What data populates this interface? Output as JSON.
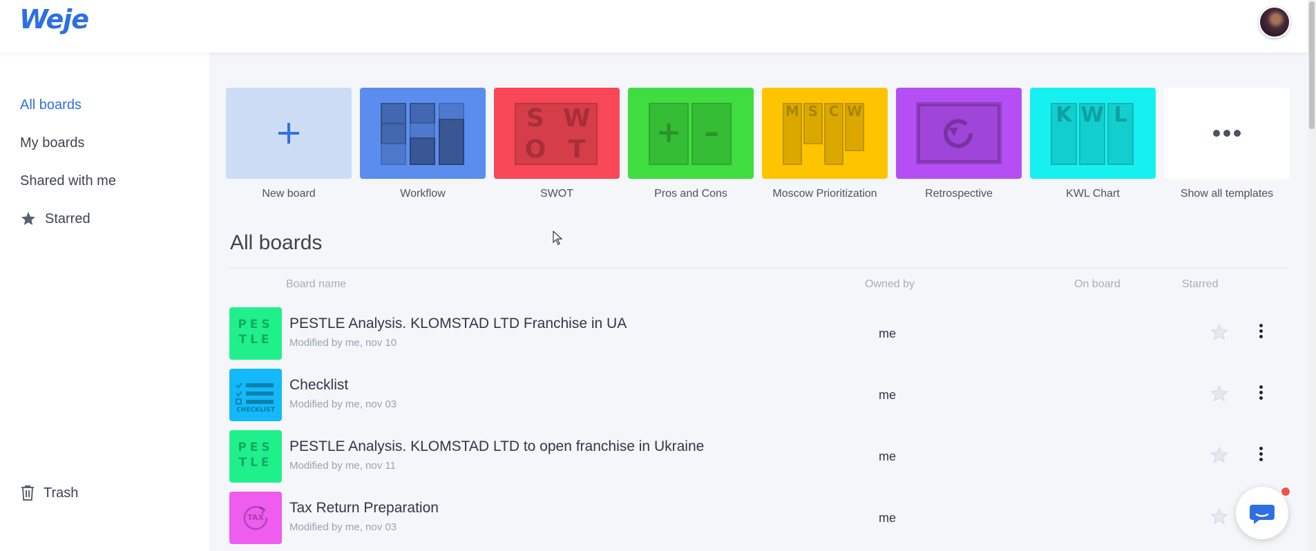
{
  "app": {
    "logo": "Weje"
  },
  "sidebar": {
    "items": [
      {
        "label": "All boards",
        "active": true
      },
      {
        "label": "My boards"
      },
      {
        "label": "Shared with me"
      },
      {
        "label": "Starred",
        "icon": "star-icon"
      }
    ],
    "trash": {
      "label": "Trash",
      "icon": "trash-icon"
    }
  },
  "templates": [
    {
      "label": "New board",
      "color": "#cddcf5",
      "icon": "plus-icon"
    },
    {
      "label": "Workflow",
      "color": "#5b8def"
    },
    {
      "label": "SWOT",
      "color": "#f84756",
      "letters": [
        "S",
        "W",
        "O",
        "T"
      ]
    },
    {
      "label": "Pros and Cons",
      "color": "#3fdd3f",
      "symbols": [
        "+",
        "–"
      ]
    },
    {
      "label": "Moscow Prioritization",
      "color": "#ffc400",
      "letters": [
        "M",
        "S",
        "C",
        "W"
      ]
    },
    {
      "label": "Retrospective",
      "color": "#b54ff5"
    },
    {
      "label": "KWL Chart",
      "color": "#17f0f0",
      "letters": [
        "K",
        "W",
        "L"
      ]
    },
    {
      "label": "Show all templates",
      "color": "#ffffff",
      "icon": "more-horizontal-icon"
    }
  ],
  "boards_section": {
    "title": "All boards",
    "columns": {
      "name": "Board name",
      "owner": "Owned by",
      "on_board": "On board",
      "starred": "Starred"
    },
    "rows": [
      {
        "name": "PESTLE Analysis. KLOMSTAD LTD Franchise in UA",
        "modified": "Modified by me, nov 10",
        "owner": "me",
        "thumb": "pestle",
        "thumb_color": "#1ff08c",
        "thumb_letters": [
          "P",
          "E",
          "S",
          "T",
          "L",
          "E"
        ]
      },
      {
        "name": "Checklist",
        "modified": "Modified by me, nov 03",
        "owner": "me",
        "thumb": "checklist",
        "thumb_color": "#13b9fa",
        "thumb_text": "CHECKLIST"
      },
      {
        "name": "PESTLE Analysis. KLOMSTAD LTD to open franchise in Ukraine",
        "modified": "Modified by me, nov 11",
        "owner": "me",
        "thumb": "pestle",
        "thumb_color": "#1ff08c",
        "thumb_letters": [
          "P",
          "E",
          "S",
          "T",
          "L",
          "E"
        ]
      },
      {
        "name": "Tax Return Preparation",
        "modified": "Modified by me, nov 03",
        "owner": "me",
        "thumb": "tax",
        "thumb_color": "#ee5cf0",
        "thumb_text": "TAX"
      }
    ]
  },
  "colors": {
    "accent": "#2f6fe4",
    "chat_badge": "#f0524a"
  }
}
